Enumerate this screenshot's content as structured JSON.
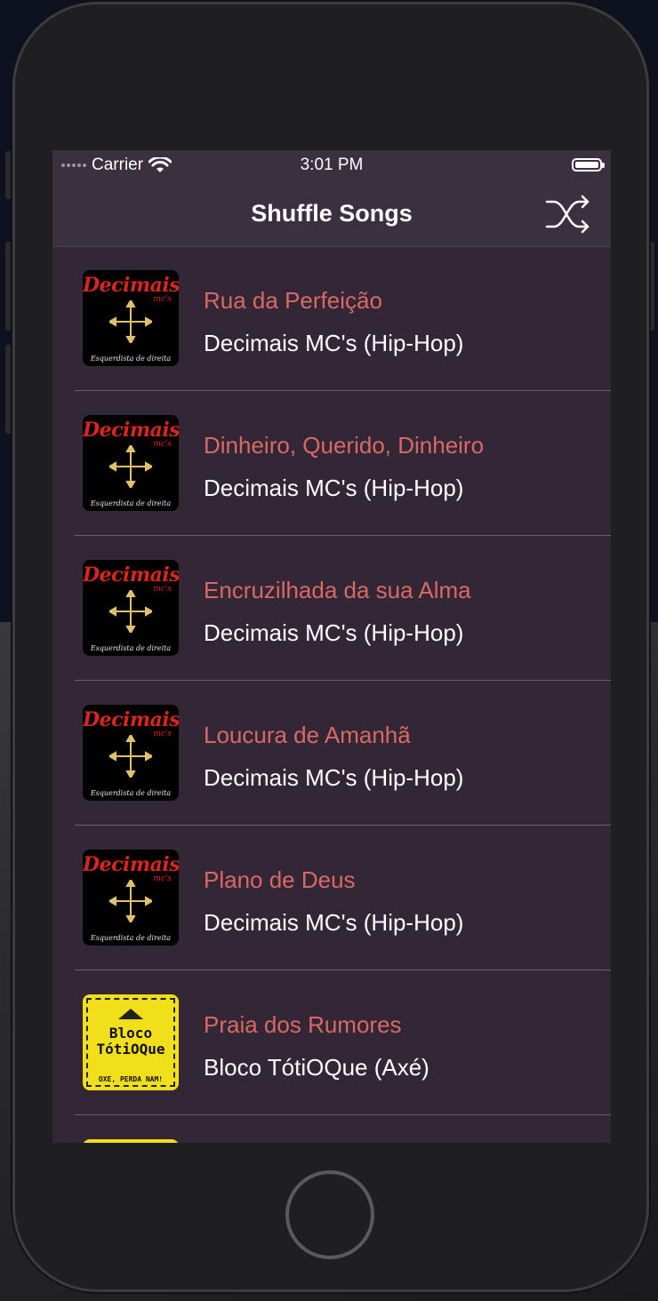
{
  "status_bar": {
    "carrier": "Carrier",
    "time": "3:01 PM"
  },
  "navbar": {
    "title": "Shuffle Songs",
    "shuffle_icon": "shuffle-icon"
  },
  "artwork": {
    "decimais": {
      "logo": "Decimais",
      "sub": "mc's",
      "tag": "Esquerdista de direita"
    },
    "bloco": {
      "line1": "Bloco",
      "line2": "TótiOQue",
      "tag": "OXE, PERDA NAM!"
    }
  },
  "songs": [
    {
      "title": "Rua da Perfeição",
      "artist": "Decimais MC's (Hip-Hop)"
    },
    {
      "title": "Dinheiro, Querido, Dinheiro",
      "artist": "Decimais MC's (Hip-Hop)"
    },
    {
      "title": "Encruzilhada da sua Alma",
      "artist": "Decimais MC's (Hip-Hop)"
    },
    {
      "title": "Loucura de Amanhã",
      "artist": "Decimais MC's (Hip-Hop)"
    },
    {
      "title": "Plano de Deus",
      "artist": "Decimais MC's (Hip-Hop)"
    },
    {
      "title": "Praia dos Rumores",
      "artist": "Bloco TótiOQue (Axé)"
    }
  ],
  "colors": {
    "title": "#d86a63",
    "background": "#322637",
    "nav": "#3b3040"
  }
}
